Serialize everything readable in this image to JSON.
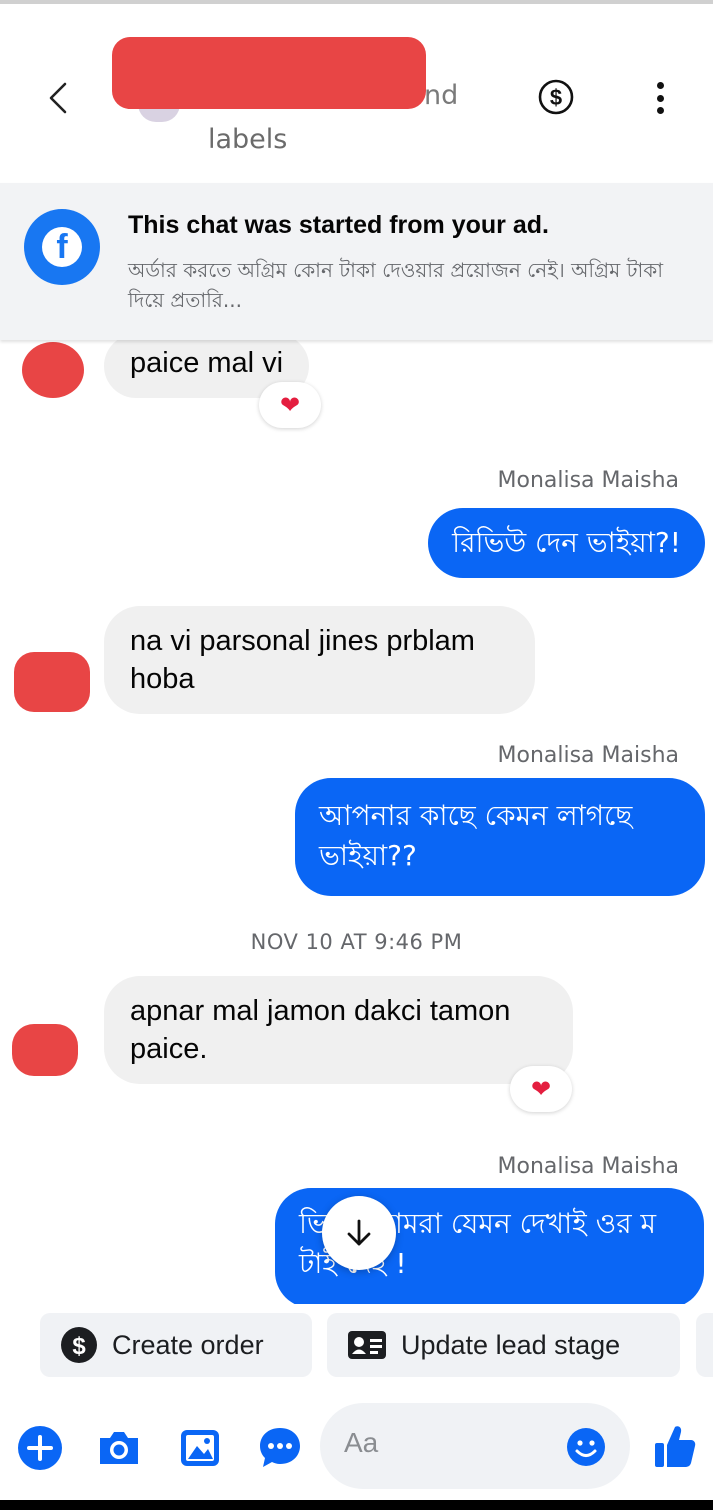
{
  "header": {
    "name_tail": "nd",
    "subtitle": "labels",
    "back_icon": "chevron-left-icon",
    "dollar_icon": "dollar-circle-icon",
    "more_icon": "more-vertical-icon"
  },
  "ad_banner": {
    "title": "This chat was started from your ad.",
    "body": "অর্ডার করতে অগ্রিম কোন টাকা দেওয়ার প্রয়োজন নেই। অগ্রিম টাকা দিয়ে প্রতারি..."
  },
  "messages": [
    {
      "direction": "in",
      "text": "paice mal vi",
      "reaction": "❤"
    },
    {
      "direction": "out",
      "sender": "Monalisa Maisha",
      "text": "রিভিউ দেন ভাইয়া?!"
    },
    {
      "direction": "in",
      "text": "na vi parsonal jines prblam hoba"
    },
    {
      "direction": "out",
      "sender": "Monalisa Maisha",
      "text": "আপনার কাছে কেমন লাগছে ভাইয়া??"
    },
    {
      "timestamp": "NOV 10 AT 9:46 PM"
    },
    {
      "direction": "in",
      "text": "apnar mal jamon dakci tamon paice.",
      "reaction": "❤"
    },
    {
      "direction": "out",
      "sender": "Monalisa Maisha",
      "text": "ভি য়া আমরা যেমন দেখাই ওর ম টাই দেই !"
    }
  ],
  "quick_actions": [
    {
      "label": "Create order",
      "icon": "dollar-circle-icon"
    },
    {
      "label": "Update lead stage",
      "icon": "contact-card-icon"
    }
  ],
  "composer": {
    "placeholder": "Aa",
    "icons": [
      "plus-circle-icon",
      "camera-icon",
      "image-icon",
      "chat-bubble-icon",
      "emoji-icon",
      "thumbs-up-icon"
    ]
  },
  "colors": {
    "accent": "#0a66f5",
    "incoming_bubble": "#f0f0f0",
    "redaction": "#e84545",
    "reaction_heart": "#e41e3f"
  }
}
